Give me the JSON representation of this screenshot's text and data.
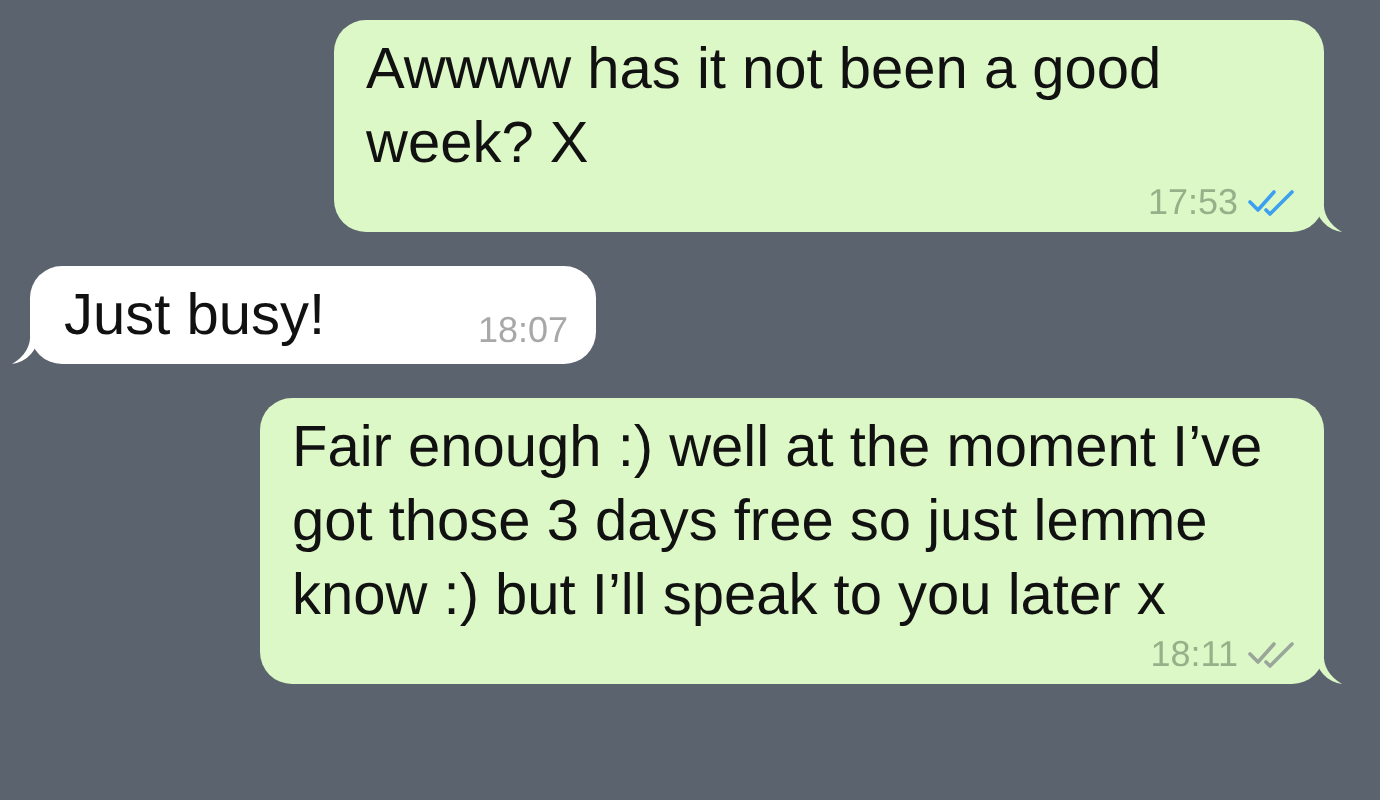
{
  "messages": [
    {
      "kind": "outgoing",
      "text": "Awwww has it not been a good week? X",
      "time": "17:53",
      "read": true
    },
    {
      "kind": "incoming",
      "text": "Just busy!",
      "time": "18:07"
    },
    {
      "kind": "outgoing",
      "text": "Fair enough :) well at the moment I’ve got those 3 days free so just lemme know :) but I’ll speak to you later x",
      "time": "18:11",
      "read": false
    }
  ]
}
